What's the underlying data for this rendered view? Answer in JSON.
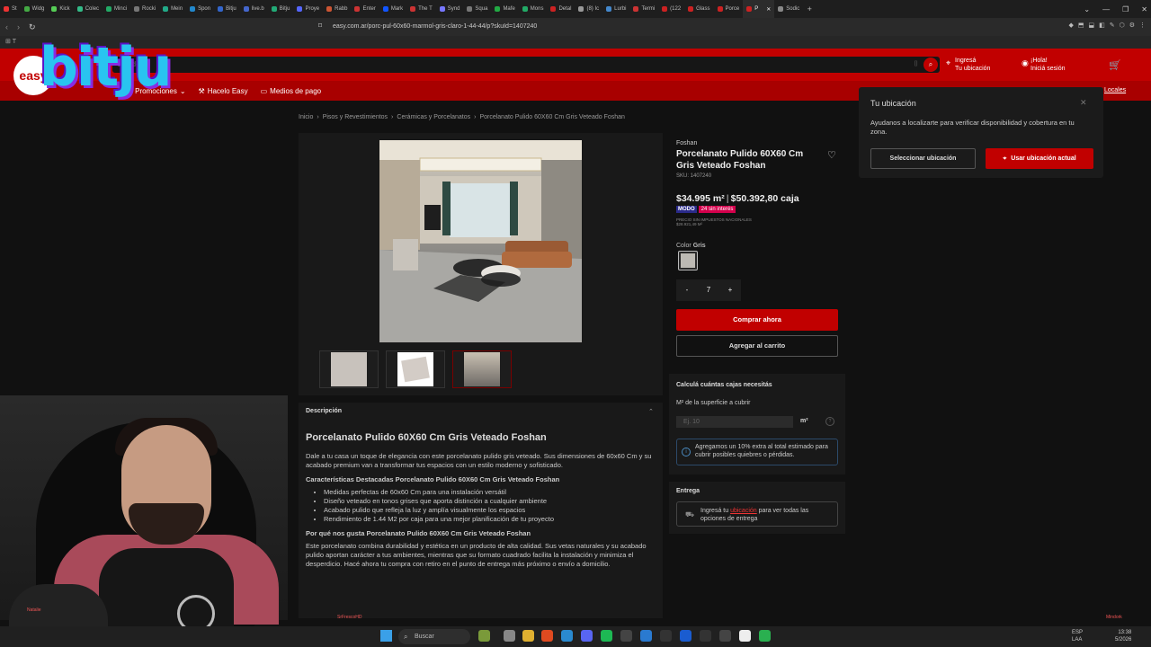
{
  "browser": {
    "tabs": [
      {
        "label": "St",
        "color": "#e33"
      },
      {
        "label": "Widg",
        "color": "#4a4"
      },
      {
        "label": "Kick",
        "color": "#5c5"
      },
      {
        "label": "Colec",
        "color": "#3b8"
      },
      {
        "label": "Minci",
        "color": "#2a6"
      },
      {
        "label": "Rocki",
        "color": "#777"
      },
      {
        "label": "Mein",
        "color": "#2a8"
      },
      {
        "label": "Spon",
        "color": "#28c"
      },
      {
        "label": "Bitju",
        "color": "#36c"
      },
      {
        "label": "live.b",
        "color": "#46c"
      },
      {
        "label": "Bitju",
        "color": "#2a7"
      },
      {
        "label": "Proye",
        "color": "#56f"
      },
      {
        "label": "Rabb",
        "color": "#c53"
      },
      {
        "label": "Enter",
        "color": "#c33"
      },
      {
        "label": "Mark",
        "color": "#15f"
      },
      {
        "label": "The T",
        "color": "#c33"
      },
      {
        "label": "Synd",
        "color": "#77f"
      },
      {
        "label": "Squa",
        "color": "#777"
      },
      {
        "label": "Mafe",
        "color": "#2a4"
      },
      {
        "label": "Mons",
        "color": "#2a6"
      },
      {
        "label": "Detal",
        "color": "#c22"
      },
      {
        "label": "(8) Ic",
        "color": "#999"
      },
      {
        "label": "Lurbi",
        "color": "#48c"
      },
      {
        "label": "Termi",
        "color": "#c33"
      },
      {
        "label": "(122",
        "color": "#c22"
      },
      {
        "label": "Glass",
        "color": "#c22"
      },
      {
        "label": "Porce",
        "color": "#c22"
      },
      {
        "label": "P",
        "color": "#c22",
        "active": true
      },
      {
        "label": "Sodic",
        "color": "#888"
      }
    ],
    "new_tab": "+",
    "window_controls": [
      "⌄",
      "—",
      "❐",
      "✕"
    ],
    "url": "easy.com.ar/porc-pul-60x60-marmol-gris-claro-1-44-44/p?skuId=1407240",
    "extensions": [
      "◆",
      "⬒",
      "⬓",
      "◧",
      "✎",
      "⬡",
      "⚙",
      "⋮"
    ],
    "bookmarks_label": "T"
  },
  "header": {
    "logo_badge": "easy",
    "overlay_logo": "bitju",
    "search_placeholder": "bu...do?",
    "search_icon": "search-icon",
    "location": {
      "line1": "Ingresá",
      "line2": "Tu ubicación"
    },
    "login": {
      "line1": "¡Hola!",
      "line2": "Iniciá sesión"
    },
    "cart_icon": "cart-icon",
    "nav": [
      {
        "label": "Promociones",
        "icon": "percent-icon"
      },
      {
        "label": "Hacelo Easy",
        "icon": "tools-icon"
      },
      {
        "label": "Medios de pago",
        "icon": "card-icon"
      }
    ],
    "locales_link": "Locales"
  },
  "breadcrumbs": [
    "Inicio",
    "Pisos y Revestimientos",
    "Cerámicas y Porcelanatos",
    "Porcelanato Pulido 60X60 Cm Gris Veteado Foshan"
  ],
  "product": {
    "brand": "Foshan",
    "title": "Porcelanato Pulido 60X60 Cm Gris Veteado Foshan",
    "sku": "SKU: 1407240",
    "price_m2": "$34.995 m²",
    "price_box": "$50.392,80 caja",
    "badge_bank": "MODO",
    "badge_installments": "24 sin interés",
    "tax_note_1": "PRECIO SIN IMPUESTOS NACIONALES",
    "tax_note_2": "$28.921,49 M²",
    "color_label": "Color",
    "color_value": "Gris",
    "quantity": "7",
    "qty_minus": "-",
    "qty_plus": "+",
    "buy_now": "Comprar ahora",
    "add_to_cart": "Agregar al carrito"
  },
  "calculator": {
    "title": "Calculá cuántas cajas necesitás",
    "field_label": "M² de la superficie a cubrir",
    "placeholder": "Ej. 10",
    "unit": "m²",
    "help": "?",
    "note": "Agregamos un 10% extra al total estimado para cubrir posibles quiebres o pérdidas."
  },
  "delivery": {
    "title": "Entrega",
    "text_before": "Ingresá tu ",
    "link": "ubicación",
    "text_after": " para ver todas las opciones de entrega"
  },
  "location_popup": {
    "title": "Tu ubicación",
    "text": "Ayudanos a localizarte para verificar disponibilidad y cobertura en tu zona.",
    "select_button": "Seleccionar ubicación",
    "use_button": "Usar ubicación actual",
    "close": "✕"
  },
  "description": {
    "section_label": "Descripción",
    "title": "Porcelanato Pulido 60X60 Cm Gris Veteado Foshan",
    "intro": "Dale a tu casa un toque de elegancia con este porcelanato pulido gris veteado. Sus dimensiones de 60x60 Cm y su acabado premium van a transformar tus espacios con un estilo moderno y sofisticado.",
    "features_title": "Características Destacadas Porcelanato Pulido 60X60 Cm Gris Veteado Foshan",
    "features": [
      "Medidas perfectas de 60x60 Cm para una instalación versátil",
      "Diseño veteado en tonos grises que aporta distinción a cualquier ambiente",
      "Acabado pulido que refleja la luz y amplía visualmente los espacios",
      "Rendimiento de 1.44 M2 por caja para una mejor planificación de tu proyecto"
    ],
    "why_title": "Por qué nos gusta Porcelanato Pulido 60X60 Cm Gris Veteado Foshan",
    "why_text": "Este porcelanato combina durabilidad y estética en un producto de alta calidad. Sus vetas naturales y su acabado pulido aportan carácter a tus ambientes, mientras que su formato cuadrado facilita la instalación y minimiza el desperdicio. Hacé ahora tu compra con retiro en el punto de entrega más próximo o envío a domicilio."
  },
  "stream": {
    "tag_left": "Natalie",
    "tag_mid": "SrFrescoHD",
    "tag_right": "Mindork"
  },
  "taskbar": {
    "search": "Buscar",
    "tray_lang": "ESP",
    "tray_layout": "LAA",
    "time": "13:38",
    "date": "5/2026"
  },
  "colors": {
    "brand_red": "#c10000",
    "dark_bg": "#111111",
    "card_bg": "#191919"
  }
}
